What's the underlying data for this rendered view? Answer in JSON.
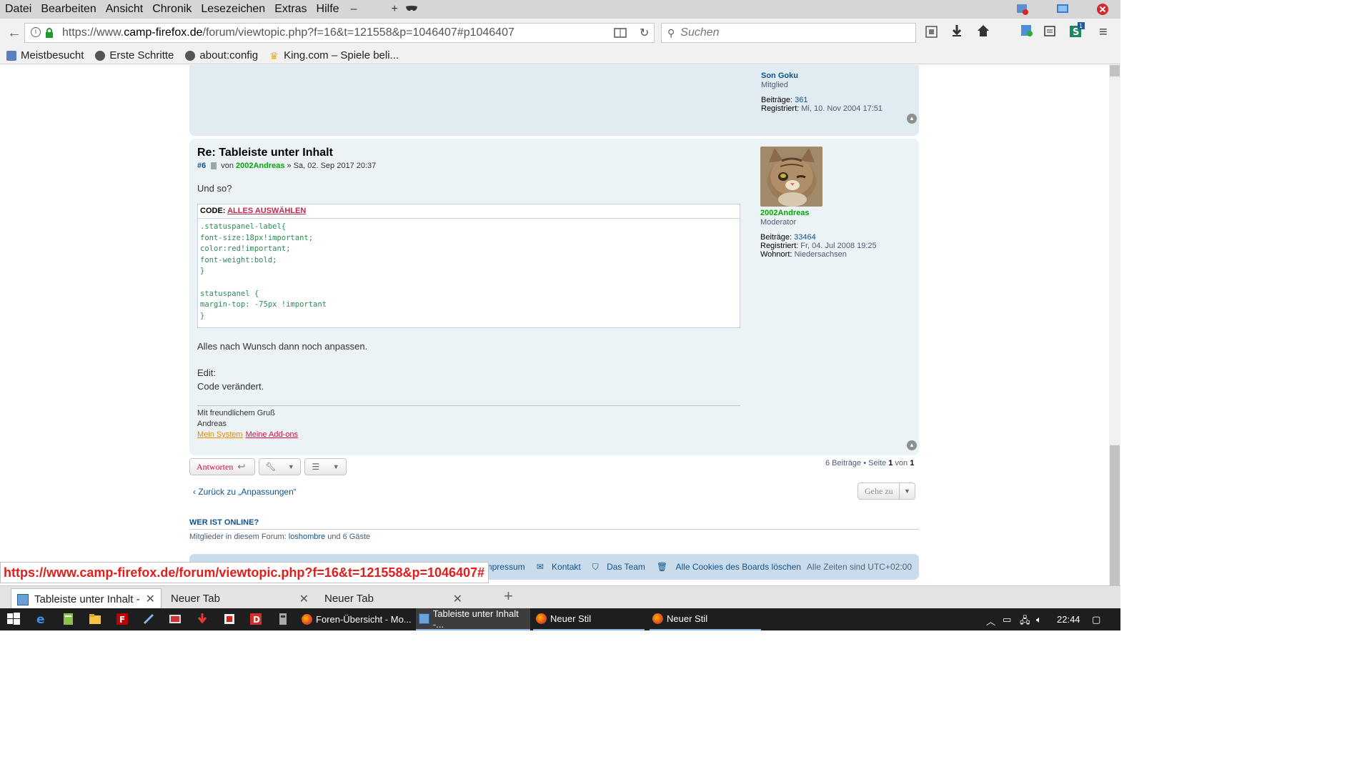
{
  "menu": {
    "items": [
      "Datei",
      "Bearbeiten",
      "Ansicht",
      "Chronik",
      "Lesezeichen",
      "Extras",
      "Hilfe"
    ]
  },
  "navbar": {
    "url_prefix": "https://www.",
    "url_domain": "camp-firefox.de",
    "url_path": "/forum/viewtopic.php?f=16&t=121558&p=1046407#p1046407",
    "search_placeholder": "Suchen"
  },
  "bookmarks": [
    "Meistbesucht",
    "Erste Schritte",
    "about:config",
    "King.com – Spiele beli..."
  ],
  "prev_post": {
    "author": "Son Goku",
    "rank": "Mitglied",
    "posts_label": "Beiträge:",
    "posts_value": "361",
    "registered_label": "Registriert:",
    "registered_value": "Mi, 10. Nov 2004 17:51"
  },
  "post": {
    "title": "Re: Tableiste unter Inhalt",
    "number": "#6",
    "by": "von",
    "author": "2002Andreas",
    "date": "» Sa, 02. Sep 2017 20:37",
    "intro": "Und so?",
    "code_label": "CODE:",
    "code_select": "ALLES AUSWÄHLEN",
    "code": ".statuspanel-label{\nfont-size:18px!important;\ncolor:red!important;\nfont-weight:bold;\n}\n\nstatuspanel {\nmargin-top: -75px !important\n}",
    "after_code": "Alles nach Wunsch dann noch anpassen.",
    "edit_label": "Edit:",
    "edit_text": "Code verändert.",
    "sig_greeting": "Mit freundlichem Gruß",
    "sig_name": "Andreas",
    "sig_link1": "Mein System",
    "sig_link2": "Meine Add-ons",
    "quote_icon": "quote-icon"
  },
  "profile": {
    "name": "2002Andreas",
    "rank": "Moderator",
    "posts_label": "Beiträge:",
    "posts_value": "33464",
    "registered_label": "Registriert:",
    "registered_value": "Fr, 04. Jul 2008 19:25",
    "location_label": "Wohnort:",
    "location_value": "Niedersachsen"
  },
  "actions": {
    "reply": "Antworten",
    "pagination_prefix": "6 Beiträge • Seite ",
    "page_current": "1",
    "pagination_of": " von ",
    "page_total": "1",
    "back": "Zurück zu „Anpassungen“",
    "goto": "Gehe zu"
  },
  "online": {
    "heading": "WER IST ONLINE?",
    "text_prefix": "Mitglieder in diesem Forum: ",
    "member": "loshombre",
    "text_suffix": " und 6 Gäste"
  },
  "footer": {
    "impressum": "Impressum",
    "kontakt": "Kontakt",
    "team": "Das Team",
    "cookies": "Alle Cookies des Boards löschen",
    "timezone": "Alle Zeiten sind UTC+02:00"
  },
  "status_url": "https://www.camp-firefox.de/forum/viewtopic.php?f=16&t=121558&p=1046407#",
  "tabs": [
    {
      "label": "Tableiste unter Inhalt - C",
      "active": true
    },
    {
      "label": "Neuer Tab",
      "active": false
    },
    {
      "label": "Neuer Tab",
      "active": false
    }
  ],
  "taskbar": {
    "items": [
      "Foren-Übersicht - Mo...",
      "Tableiste unter Inhalt -...",
      "Neuer Stil",
      "Neuer Stil"
    ],
    "clock": "22:44"
  },
  "colors": {
    "post_bg": "#ecf3f7",
    "prev_post_bg": "#e1ebf2",
    "moderator": "#00aa00",
    "link": "#105289",
    "status_url": "#e31c1c"
  }
}
